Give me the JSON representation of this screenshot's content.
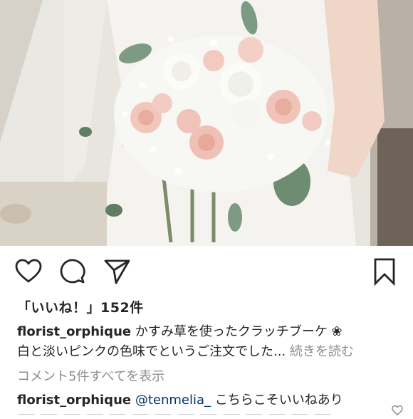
{
  "post": {
    "likes_text": "「いいね！」152件",
    "caption": {
      "username": "florist_orphique",
      "text_line1": " かすみ草を使ったクラッチブーケ ❀",
      "text_line2": "白と淡いピンクの色味でというご注文でした... ",
      "more": "続きを読む"
    },
    "view_comments": "コメント5件すべてを表示",
    "comment": {
      "username": "florist_orphique",
      "mention": "@tenmelia_",
      "text": " こちらこそいいねあり"
    }
  },
  "icons": {
    "like": "heart-icon",
    "comment": "comment-icon",
    "share": "send-icon",
    "save": "bookmark-icon",
    "comment_like": "small-heart-icon"
  },
  "colors": {
    "text": "#262626",
    "muted": "#8e8e8e",
    "mention": "#003569"
  }
}
